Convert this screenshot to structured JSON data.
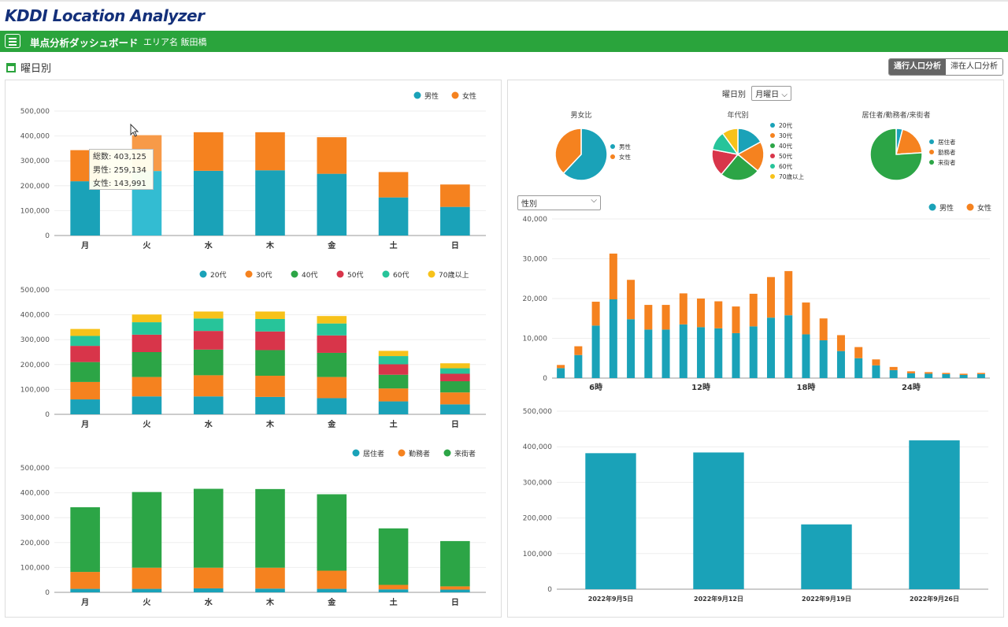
{
  "app": {
    "logo": "KDDI Location Analyzer",
    "title": "単点分析ダッシュボード",
    "area": "エリア名 飯田橋"
  },
  "section": {
    "title": "曜日別"
  },
  "tabs": [
    {
      "label": "通行人口分析",
      "active": true
    },
    {
      "label": "滞在人口分析",
      "active": false
    }
  ],
  "colors": {
    "teal": "#1aa2b8",
    "orange": "#f5821f",
    "green": "#2ca546",
    "red": "#d8354a",
    "mint": "#27c49a",
    "yellow": "#f7c21a",
    "brand_green": "#2aa43c"
  },
  "weekday_filter": {
    "label": "曜日別",
    "value": "月曜日"
  },
  "gender_select": {
    "value": "性別"
  },
  "tooltip": {
    "line1": "総数: 403,125",
    "line2": "男性: 259,134",
    "line3": "女性: 143,991"
  },
  "chart_data": [
    {
      "id": "gender-by-weekday",
      "type": "bar",
      "stacked": true,
      "categories": [
        "月",
        "火",
        "水",
        "木",
        "金",
        "土",
        "日"
      ],
      "ylim": [
        0,
        500000
      ],
      "yticks": [
        "0",
        "100,000",
        "200,000",
        "300,000",
        "400,000",
        "500,000"
      ],
      "series": [
        {
          "name": "男性",
          "color": "#1aa2b8",
          "values": [
            218000,
            259134,
            260000,
            262000,
            248000,
            153000,
            115000
          ]
        },
        {
          "name": "女性",
          "color": "#f5821f",
          "values": [
            125000,
            143991,
            155000,
            153000,
            147000,
            102000,
            90000
          ]
        }
      ],
      "legend": "top-right",
      "grid": true
    },
    {
      "id": "age-by-weekday",
      "type": "bar",
      "stacked": true,
      "categories": [
        "月",
        "火",
        "水",
        "木",
        "金",
        "土",
        "日"
      ],
      "ylim": [
        0,
        500000
      ],
      "yticks": [
        "0",
        "100,000",
        "200,000",
        "300,000",
        "400,000",
        "500,000"
      ],
      "series": [
        {
          "name": "20代",
          "color": "#1aa2b8",
          "values": [
            60000,
            72000,
            72000,
            70000,
            65000,
            52000,
            40000
          ]
        },
        {
          "name": "30代",
          "color": "#f5821f",
          "values": [
            70000,
            78000,
            85000,
            85000,
            85000,
            52000,
            48000
          ]
        },
        {
          "name": "40代",
          "color": "#2ca546",
          "values": [
            80000,
            100000,
            103000,
            103000,
            97000,
            55000,
            45000
          ]
        },
        {
          "name": "50代",
          "color": "#d8354a",
          "values": [
            65000,
            70000,
            75000,
            75000,
            70000,
            42000,
            30000
          ]
        },
        {
          "name": "60代",
          "color": "#27c49a",
          "values": [
            40000,
            50000,
            50000,
            50000,
            48000,
            33000,
            22000
          ]
        },
        {
          "name": "70歳以上",
          "color": "#f7c21a",
          "values": [
            28000,
            31000,
            28000,
            30000,
            30000,
            21000,
            20000
          ]
        }
      ],
      "legend": "top-right",
      "grid": true
    },
    {
      "id": "type-by-weekday",
      "type": "bar",
      "stacked": true,
      "categories": [
        "月",
        "火",
        "水",
        "木",
        "金",
        "土",
        "日"
      ],
      "ylim": [
        0,
        500000
      ],
      "yticks": [
        "0",
        "100,000",
        "200,000",
        "300,000",
        "400,000",
        "500,000"
      ],
      "series": [
        {
          "name": "居住者",
          "color": "#1aa2b8",
          "values": [
            14000,
            14000,
            16000,
            15000,
            14000,
            12000,
            11000
          ]
        },
        {
          "name": "勤務者",
          "color": "#f5821f",
          "values": [
            68000,
            85000,
            83000,
            84000,
            73000,
            18000,
            13000
          ]
        },
        {
          "name": "来街者",
          "color": "#2ca546",
          "values": [
            260000,
            304000,
            317000,
            316000,
            307000,
            227000,
            182000
          ]
        }
      ],
      "legend": "top-right",
      "grid": true
    },
    {
      "id": "gender-pie",
      "type": "pie",
      "title": "男女比",
      "labels": [
        "男性",
        "女性"
      ],
      "values": [
        62,
        38
      ],
      "colors": [
        "#1aa2b8",
        "#f5821f"
      ],
      "legend": "right"
    },
    {
      "id": "age-pie",
      "type": "pie",
      "title": "年代別",
      "labels": [
        "20代",
        "30代",
        "40代",
        "50代",
        "60代",
        "70歳以上"
      ],
      "values": [
        17,
        19,
        25,
        17,
        12,
        10
      ],
      "colors": [
        "#1aa2b8",
        "#f5821f",
        "#2ca546",
        "#d8354a",
        "#27c49a",
        "#f7c21a"
      ],
      "legend": "right"
    },
    {
      "id": "type-pie",
      "type": "pie",
      "title": "居住者/勤務者/来街者",
      "labels": [
        "居住者",
        "勤務者",
        "来街者"
      ],
      "values": [
        4,
        20,
        76
      ],
      "colors": [
        "#1aa2b8",
        "#f5821f",
        "#2ca546"
      ],
      "legend": "right"
    },
    {
      "id": "hourly",
      "type": "bar",
      "stacked": true,
      "x": [
        4,
        5,
        6,
        7,
        8,
        9,
        10,
        11,
        12,
        13,
        14,
        15,
        16,
        17,
        18,
        19,
        20,
        21,
        22,
        23,
        24,
        25,
        26,
        27,
        28
      ],
      "xticks": [
        {
          "at": 6,
          "label": "6時"
        },
        {
          "at": 12,
          "label": "12時"
        },
        {
          "at": 18,
          "label": "18時"
        },
        {
          "at": 24,
          "label": "24時"
        }
      ],
      "ylim": [
        0,
        40000
      ],
      "yticks": [
        "0",
        "10,000",
        "20,000",
        "30,000",
        "40,000"
      ],
      "series": [
        {
          "name": "男性",
          "color": "#1aa2b8",
          "values": [
            2500,
            5800,
            13200,
            19800,
            14800,
            12200,
            12200,
            13500,
            12800,
            12500,
            11300,
            13000,
            15200,
            15800,
            11000,
            9500,
            6800,
            5000,
            3200,
            2000,
            1200,
            1100,
            1000,
            800,
            1000
          ]
        },
        {
          "name": "女性",
          "color": "#f5821f",
          "values": [
            800,
            2200,
            6000,
            11500,
            9900,
            6200,
            6200,
            7800,
            7200,
            6800,
            6700,
            8200,
            10200,
            11100,
            8000,
            5500,
            4000,
            2800,
            1500,
            800,
            500,
            400,
            300,
            300,
            300
          ]
        }
      ],
      "legend": "top-right",
      "grid": true
    },
    {
      "id": "weekly",
      "type": "bar",
      "categories": [
        "2022年9月5日",
        "2022年9月12日",
        "2022年9月19日",
        "2022年9月26日"
      ],
      "values": [
        382000,
        384000,
        182000,
        418000
      ],
      "color": "#1aa2b8",
      "ylim": [
        0,
        500000
      ],
      "yticks": [
        "0",
        "100,000",
        "200,000",
        "300,000",
        "400,000",
        "500,000"
      ],
      "grid": true
    }
  ]
}
